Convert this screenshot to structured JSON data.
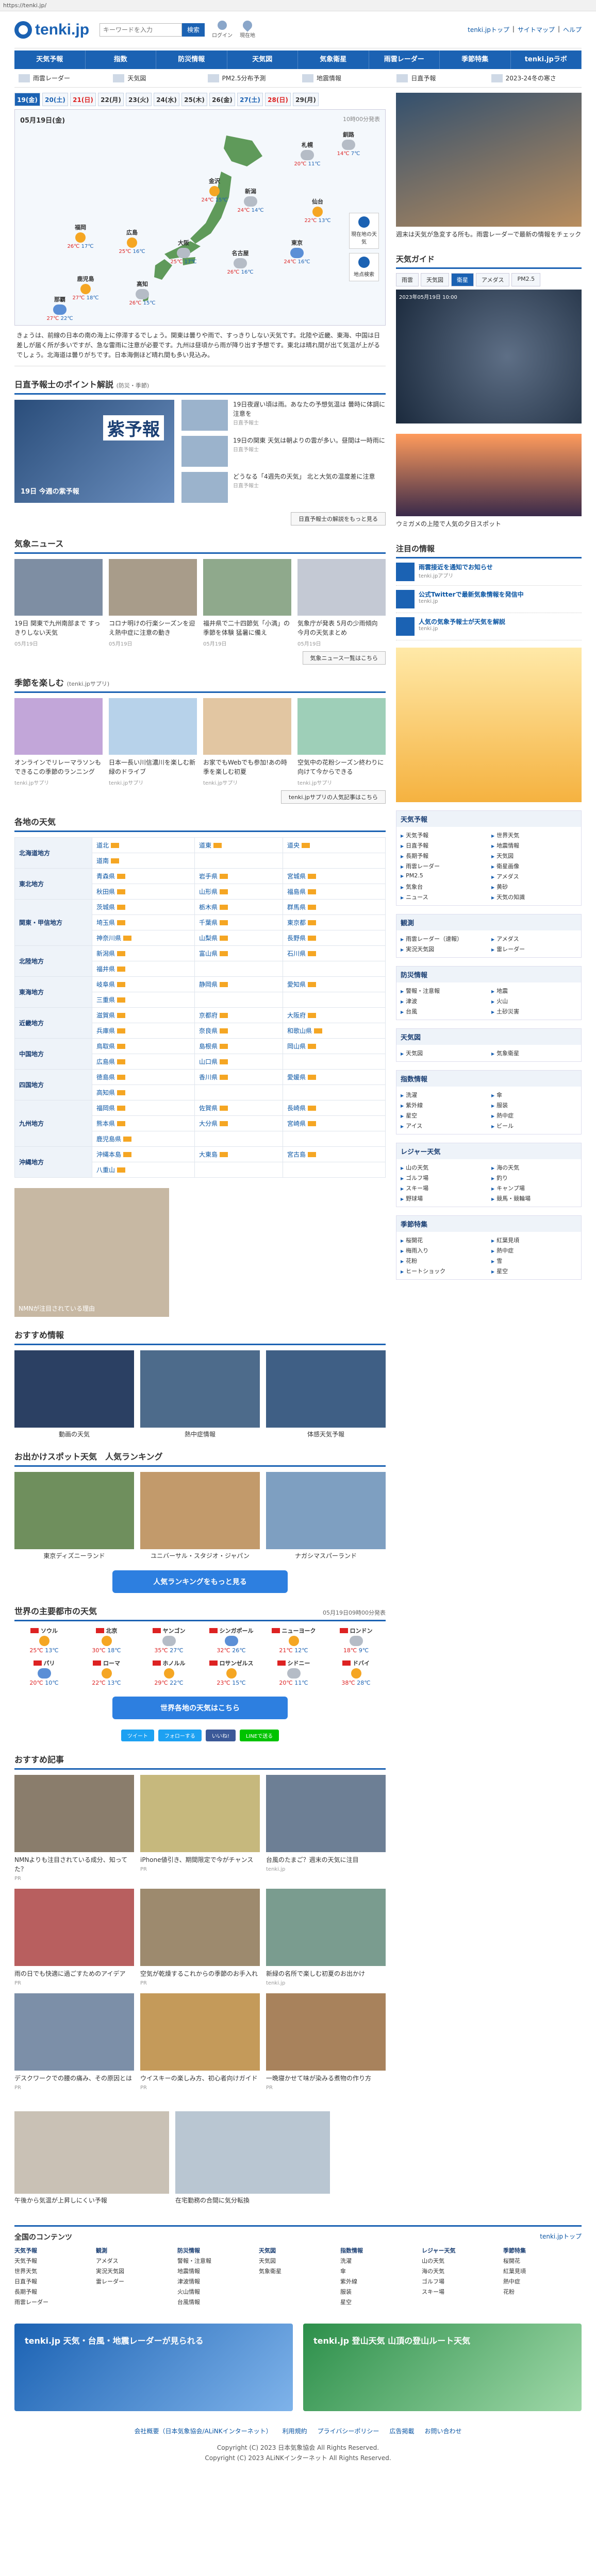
{
  "url": "https://tenki.jp/",
  "header": {
    "logo": "tenki.jp",
    "search_placeholder": "キーワードを入力",
    "search_button": "検索",
    "icons": [
      "ログイン",
      "現在地"
    ],
    "links": [
      "tenki.jpトップ",
      "サイトマップ",
      "ヘルプ"
    ]
  },
  "nav": [
    "天気予報",
    "指数",
    "防災情報",
    "天気図",
    "気象衛星",
    "雨雲レーダー",
    "季節特集",
    "tenki.jpラボ"
  ],
  "subnav": [
    "雨雲レーダー",
    "天気図",
    "PM2.5分布予測",
    "地震情報",
    "日直予報",
    "2023-24冬の寒さ"
  ],
  "days": [
    {
      "label": "19(金)",
      "cls": "active"
    },
    {
      "label": "20(土)",
      "cls": "sat"
    },
    {
      "label": "21(日)",
      "cls": "sun"
    },
    {
      "label": "22(月)",
      "cls": ""
    },
    {
      "label": "23(火)",
      "cls": ""
    },
    {
      "label": "24(水)",
      "cls": ""
    },
    {
      "label": "25(木)",
      "cls": ""
    },
    {
      "label": "26(金)",
      "cls": ""
    },
    {
      "label": "27(土)",
      "cls": "sat"
    },
    {
      "label": "28(日)",
      "cls": "sun"
    },
    {
      "label": "29(月)",
      "cls": ""
    }
  ],
  "map": {
    "title": "05月19日(金)",
    "time": "10時00分発表",
    "cities": [
      {
        "name": "札幌",
        "hi": "20℃",
        "lo": "11℃",
        "w": "cloudy"
      },
      {
        "name": "釧路",
        "hi": "14℃",
        "lo": "7℃",
        "w": "cloudy"
      },
      {
        "name": "仙台",
        "hi": "22℃",
        "lo": "13℃",
        "w": "sunny"
      },
      {
        "name": "新潟",
        "hi": "24℃",
        "lo": "14℃",
        "w": "cloudy"
      },
      {
        "name": "東京",
        "hi": "24℃",
        "lo": "16℃",
        "w": "rainy"
      },
      {
        "name": "名古屋",
        "hi": "26℃",
        "lo": "16℃",
        "w": "cloudy"
      },
      {
        "name": "大阪",
        "hi": "25℃",
        "lo": "17℃",
        "w": "cloudy"
      },
      {
        "name": "広島",
        "hi": "25℃",
        "lo": "16℃",
        "w": "sunny"
      },
      {
        "name": "福岡",
        "hi": "26℃",
        "lo": "17℃",
        "w": "sunny"
      },
      {
        "name": "那覇",
        "hi": "27℃",
        "lo": "22℃",
        "w": "rainy"
      },
      {
        "name": "金沢",
        "hi": "24℃",
        "lo": "15℃",
        "w": "sunny"
      },
      {
        "name": "高知",
        "hi": "26℃",
        "lo": "15℃",
        "w": "cloudy"
      },
      {
        "name": "鹿児島",
        "hi": "27℃",
        "lo": "18℃",
        "w": "sunny"
      }
    ],
    "side_buttons": [
      "現在地の天気",
      "地点検索"
    ]
  },
  "outlook": "きょうは、前線の日本の南の海上に停滞するでしょう。関東は曇りや雨で、すっきりしない天気です。北陸や近畿、東海、中国は日差しが届く所が多いですが、急な雷雨に注意が必要です。九州は昼頃から雨が降り出す予想です。東北は晴れ間が出て気温が上がるでしょう。北海道は曇りがちです。日本海側ほど晴れ間も多い見込み。",
  "point": {
    "title": "日直予報士のポイント解説",
    "sub": "(防災・季節)",
    "feature_title": "紫予報",
    "feature_caption": "19日 今週の紫予報",
    "items": [
      {
        "txt": "19日夜遅い頃は雨。あなたの予想気温は 曇時に体調に注意を",
        "meta": "日直予報士"
      },
      {
        "txt": "19日の関東 天気は朝よりの雲が多い。昼間は一時雨に",
        "meta": "日直予報士"
      },
      {
        "txt": "どうなる「4週先の天気」 北と大気の温度差に注意",
        "meta": "日直予報士"
      }
    ],
    "more": "日直予報士の解説をもっと見る"
  },
  "news": {
    "title": "気象ニュース",
    "items": [
      {
        "txt": "19日 関東で九州南部まで すっきりしない天気",
        "meta": "05月19日"
      },
      {
        "txt": "コロナ明けの行楽シーズンを迎え熱中症に注意の動き",
        "meta": "05月19日"
      },
      {
        "txt": "福井県で二十四節気「小満」の季節を体験 猛暑に備え",
        "meta": "05月19日"
      },
      {
        "txt": "気象庁が発表 5月の少雨傾向 今月の天気まとめ",
        "meta": "05月19日"
      }
    ],
    "more": "気象ニュース一覧はこちら"
  },
  "season": {
    "title": "季節を楽しむ",
    "sub": "(tenki.jpサプリ)",
    "items": [
      {
        "txt": "オンラインでリレーマラソンもできるこの季節のランニング",
        "meta": "tenki.jpサプリ"
      },
      {
        "txt": "日本一長い川信濃川を楽しむ新緑のドライブ",
        "meta": "tenki.jpサプリ"
      },
      {
        "txt": "お家でもWebでも参加!あの時季を楽しむ初夏",
        "meta": "tenki.jpサプリ"
      },
      {
        "txt": "空気中の花粉シーズン終わりに向けて今からできる",
        "meta": "tenki.jpサプリ"
      }
    ],
    "more": "tenki.jpサプリの人気記事はこちら"
  },
  "regions": {
    "title": "各地の天気",
    "rows": [
      {
        "name": "北海道地方",
        "cells": [
          "道北",
          "道東",
          "道央",
          "道南"
        ]
      },
      {
        "name": "東北地方",
        "cells": [
          "青森県",
          "岩手県",
          "宮城県",
          "秋田県",
          "山形県",
          "福島県"
        ]
      },
      {
        "name": "関東・甲信地方",
        "cells": [
          "茨城県",
          "栃木県",
          "群馬県",
          "埼玉県",
          "千葉県",
          "東京都",
          "神奈川県",
          "山梨県",
          "長野県"
        ]
      },
      {
        "name": "北陸地方",
        "cells": [
          "新潟県",
          "富山県",
          "石川県",
          "福井県"
        ]
      },
      {
        "name": "東海地方",
        "cells": [
          "岐阜県",
          "静岡県",
          "愛知県",
          "三重県"
        ]
      },
      {
        "name": "近畿地方",
        "cells": [
          "滋賀県",
          "京都府",
          "大阪府",
          "兵庫県",
          "奈良県",
          "和歌山県"
        ]
      },
      {
        "name": "中国地方",
        "cells": [
          "鳥取県",
          "島根県",
          "岡山県",
          "広島県",
          "山口県"
        ]
      },
      {
        "name": "四国地方",
        "cells": [
          "徳島県",
          "香川県",
          "愛媛県",
          "高知県"
        ]
      },
      {
        "name": "九州地方",
        "cells": [
          "福岡県",
          "佐賀県",
          "長崎県",
          "熊本県",
          "大分県",
          "宮崎県",
          "鹿児島県"
        ]
      },
      {
        "name": "沖縄地方",
        "cells": [
          "沖縄本島",
          "大東島",
          "宮古島",
          "八重山"
        ]
      }
    ]
  },
  "ad1_caption": "NMNが注目されている理由",
  "recommend": {
    "title": "おすすめ情報",
    "items": [
      "動画の天気",
      "熱中症情報",
      "体感天気予報"
    ]
  },
  "spots": {
    "title": "お出かけスポット天気",
    "sub": "人気ランキング",
    "items": [
      "東京ディズニーランド",
      "ユニバーサル・スタジオ・ジャパン",
      "ナガシマスパーランド"
    ],
    "button": "人気ランキングをもっと見る"
  },
  "world": {
    "title": "世界の主要都市の天気",
    "time": "05月19日09時00分発表",
    "cities": [
      {
        "name": "ソウル",
        "hi": "25℃",
        "lo": "13℃",
        "w": "sunny"
      },
      {
        "name": "北京",
        "hi": "30℃",
        "lo": "18℃",
        "w": "sunny"
      },
      {
        "name": "ヤンゴン",
        "hi": "35℃",
        "lo": "27℃",
        "w": "cloudy"
      },
      {
        "name": "シンガポール",
        "hi": "32℃",
        "lo": "26℃",
        "w": "rainy"
      },
      {
        "name": "ニューヨーク",
        "hi": "21℃",
        "lo": "12℃",
        "w": "sunny"
      },
      {
        "name": "ロンドン",
        "hi": "18℃",
        "lo": "9℃",
        "w": "cloudy"
      },
      {
        "name": "パリ",
        "hi": "20℃",
        "lo": "10℃",
        "w": "rainy"
      },
      {
        "name": "ローマ",
        "hi": "22℃",
        "lo": "13℃",
        "w": "sunny"
      },
      {
        "name": "ホノルル",
        "hi": "29℃",
        "lo": "22℃",
        "w": "sunny"
      },
      {
        "name": "ロサンゼルス",
        "hi": "23℃",
        "lo": "15℃",
        "w": "sunny"
      },
      {
        "name": "シドニー",
        "hi": "20℃",
        "lo": "11℃",
        "w": "cloudy"
      },
      {
        "name": "ドバイ",
        "hi": "38℃",
        "lo": "28℃",
        "w": "sunny"
      }
    ],
    "button": "世界各地の天気はこちら"
  },
  "share": [
    "ツイート",
    "フォローする",
    "いいね!",
    "LINEで送る"
  ],
  "articles": {
    "title": "おすすめ記事",
    "items": [
      {
        "txt": "NMNよりも注目されている成分、知ってた？",
        "meta": "PR"
      },
      {
        "txt": "iPhone値引き、期間限定で今がチャンス",
        "meta": "PR"
      },
      {
        "txt": "台風のたまご？週末の天気に注目",
        "meta": "tenki.jp"
      },
      {
        "txt": "雨の日でも快適に過ごすためのアイデア",
        "meta": "PR"
      },
      {
        "txt": "空気が乾燥するこれからの季節のお手入れ",
        "meta": "PR"
      },
      {
        "txt": "新緑の名所で楽しむ初夏のお出かけ",
        "meta": "tenki.jp"
      },
      {
        "txt": "デスクワークでの腰の痛み、その原因とは",
        "meta": "PR"
      },
      {
        "txt": "ウイスキーの楽しみ方、初心者向けガイド",
        "meta": "PR"
      },
      {
        "txt": "一晩寝かせて味が染みる煮物の作り方",
        "meta": "PR"
      }
    ]
  },
  "ad2": [
    "午後から気温が上昇しにくい予報",
    "在宅勤務の合間に気分転換"
  ],
  "right": {
    "hero_caption": "週末は天気が急変する所も。雨雲レーダーで最新の情報をチェック",
    "sat_title": "天気ガイド",
    "sat_tabs": [
      "雨雲",
      "天気図",
      "衛星",
      "アメダス",
      "PM2.5"
    ],
    "sat_time": "2023年05月19日 10:00",
    "promo_caption": "ウミガメの上陸で人気の夕日スポット",
    "info_title": "注目の情報",
    "infos": [
      {
        "txt": "雨雲接近を通知でお知らせ",
        "sub": "tenki.jpアプリ"
      },
      {
        "txt": "公式Twitterで最新気象情報を発信中",
        "sub": "tenki.jp"
      },
      {
        "txt": "人気の気象予報士が天気を解説",
        "sub": "tenki.jp"
      }
    ],
    "link_blocks": [
      {
        "head": "天気予報",
        "items": [
          "天気予報",
          "世界天気",
          "日直予報",
          "地震情報",
          "長期予報",
          "天気図",
          "雨雲レーダー",
          "衛星画像",
          "PM2.5",
          "アメダス",
          "気象台",
          "黄砂",
          "ニュース",
          "天気の知識"
        ]
      },
      {
        "head": "観測",
        "items": [
          "雨雲レーダー（速報）",
          "アメダス",
          "実況天気図",
          "雷レーダー"
        ]
      },
      {
        "head": "防災情報",
        "items": [
          "警報・注意報",
          "地震",
          "津波",
          "火山",
          "台風",
          "土砂災害"
        ]
      },
      {
        "head": "天気図",
        "items": [
          "天気図",
          "気象衛星"
        ]
      },
      {
        "head": "指数情報",
        "items": [
          "洗濯",
          "傘",
          "紫外線",
          "服装",
          "星空",
          "熱中症",
          "アイス",
          "ビール"
        ]
      },
      {
        "head": "レジャー天気",
        "items": [
          "山の天気",
          "海の天気",
          "ゴルフ場",
          "釣り",
          "スキー場",
          "キャンプ場",
          "野球場",
          "競馬・競輪場"
        ]
      },
      {
        "head": "季節特集",
        "items": [
          "桜開花",
          "紅葉見頃",
          "梅雨入り",
          "熱中症",
          "花粉",
          "雪",
          "ヒートショック",
          "星空"
        ]
      }
    ]
  },
  "footer": {
    "title": "全国のコンテンツ",
    "top_link": "tenki.jpトップ",
    "cols": [
      {
        "h": "天気予報",
        "items": [
          "天気予報",
          "世界天気",
          "日直予報",
          "長期予報",
          "雨雲レーダー"
        ]
      },
      {
        "h": "観測",
        "items": [
          "アメダス",
          "実況天気図",
          "雷レーダー"
        ]
      },
      {
        "h": "防災情報",
        "items": [
          "警報・注意報",
          "地震情報",
          "津波情報",
          "火山情報",
          "台風情報"
        ]
      },
      {
        "h": "天気図",
        "items": [
          "天気図",
          "気象衛星"
        ]
      },
      {
        "h": "指数情報",
        "items": [
          "洗濯",
          "傘",
          "紫外線",
          "服装",
          "星空"
        ]
      },
      {
        "h": "レジャー天気",
        "items": [
          "山の天気",
          "海の天気",
          "ゴルフ場",
          "スキー場"
        ]
      },
      {
        "h": "季節特集",
        "items": [
          "桜開花",
          "紅葉見頃",
          "熱中症",
          "花粉"
        ]
      }
    ],
    "links": [
      "会社概要（日本気象協会/ALiNKインターネット）",
      "利用規約",
      "プライバシーポリシー",
      "広告掲載",
      "お問い合わせ"
    ],
    "copyright1": "Copyright (C) 2023 日本気象協会 All Rights Reserved.",
    "copyright2": "Copyright (C) 2023 ALiNKインターネット All Rights Reserved."
  },
  "app_banner": [
    "tenki.jp 天気・台風・地震レーダーが見られる",
    "tenki.jp 登山天気 山頂の登山ルート天気"
  ]
}
